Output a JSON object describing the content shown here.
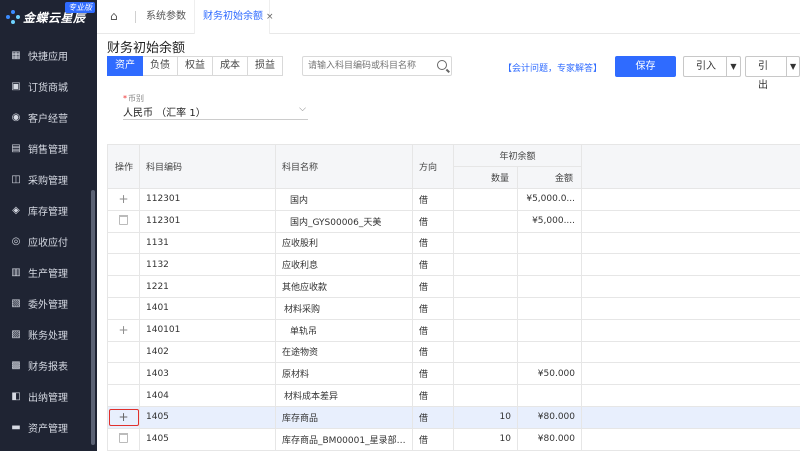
{
  "app": {
    "brand": "金蝶云星辰",
    "badge": "专业版"
  },
  "sidebar": {
    "items": [
      {
        "label": "快捷应用",
        "icon": "apps-icon"
      },
      {
        "label": "订货商城",
        "icon": "store-icon"
      },
      {
        "label": "客户经营",
        "icon": "customer-icon"
      },
      {
        "label": "销售管理",
        "icon": "sales-icon"
      },
      {
        "label": "采购管理",
        "icon": "cart-icon"
      },
      {
        "label": "库存管理",
        "icon": "inventory-icon"
      },
      {
        "label": "应收应付",
        "icon": "receivable-icon"
      },
      {
        "label": "生产管理",
        "icon": "factory-icon"
      },
      {
        "label": "委外管理",
        "icon": "outsource-icon"
      },
      {
        "label": "账务处理",
        "icon": "ledger-icon"
      },
      {
        "label": "财务报表",
        "icon": "report-icon"
      },
      {
        "label": "出纳管理",
        "icon": "cashier-icon"
      },
      {
        "label": "资产管理",
        "icon": "asset-icon"
      }
    ]
  },
  "tabs": {
    "items": [
      {
        "label": "系统参数"
      },
      {
        "label": "财务初始余额",
        "close": "×"
      }
    ]
  },
  "page": {
    "title": "财务初始余额"
  },
  "toolbar": {
    "segments": [
      "资产",
      "负债",
      "权益",
      "成本",
      "损益"
    ],
    "search_placeholder": "请输入科目编码或科目名称",
    "expert_link": "【会计问题，专家解答】",
    "save_label": "保存",
    "import_label": "引入",
    "export_label": "引出"
  },
  "currency": {
    "label": "币别",
    "required_mark": "*",
    "value": "人民币 （汇率 1）"
  },
  "table": {
    "headers": {
      "op": "操作",
      "code": "科目编码",
      "name": "科目名称",
      "direction": "方向",
      "group": "年初余额",
      "qty": "数量",
      "amount": "金额"
    },
    "rows": [
      {
        "op": "plus",
        "code": "112301",
        "name": "国内",
        "direction": "借",
        "qty": "",
        "amount": "¥5,000.0...",
        "indent": 2
      },
      {
        "op": "trash",
        "code": "112301",
        "name": "国内_GYS00006_天美",
        "direction": "借",
        "qty": "",
        "amount": "¥5,000....",
        "indent": 2
      },
      {
        "op": "",
        "code": "1131",
        "name": "应收股利",
        "direction": "借",
        "qty": "",
        "amount": "",
        "indent": 0
      },
      {
        "op": "",
        "code": "1132",
        "name": "应收利息",
        "direction": "借",
        "qty": "",
        "amount": "",
        "indent": 0
      },
      {
        "op": "",
        "code": "1221",
        "name": "其他应收款",
        "direction": "借",
        "qty": "",
        "amount": "",
        "indent": 0
      },
      {
        "op": "",
        "code": "1401",
        "name": "材料采购",
        "direction": "借",
        "qty": "",
        "amount": "",
        "indent": 1
      },
      {
        "op": "plus",
        "code": "140101",
        "name": "单轨吊",
        "direction": "借",
        "qty": "",
        "amount": "",
        "indent": 2
      },
      {
        "op": "",
        "code": "1402",
        "name": "在途物资",
        "direction": "借",
        "qty": "",
        "amount": "",
        "indent": 0
      },
      {
        "op": "",
        "code": "1403",
        "name": "原材料",
        "direction": "借",
        "qty": "",
        "amount": "¥50.000",
        "indent": 0
      },
      {
        "op": "",
        "code": "1404",
        "name": "材料成本差异",
        "direction": "借",
        "qty": "",
        "amount": "",
        "indent": 1
      },
      {
        "op": "plus-focus",
        "code": "1405",
        "name": "库存商品",
        "direction": "借",
        "qty": "10",
        "amount": "¥80.000",
        "indent": 0,
        "selected": true
      },
      {
        "op": "trash",
        "code": "1405",
        "name": "库存商品_BM00001_星录部1...",
        "direction": "借",
        "qty": "10",
        "amount": "¥80.000",
        "indent": 0
      }
    ]
  },
  "colors": {
    "primary": "#2f6bff",
    "sidebar_bg": "#1f2433",
    "focus": "#e0302c",
    "selected_row": "#e8effd"
  }
}
